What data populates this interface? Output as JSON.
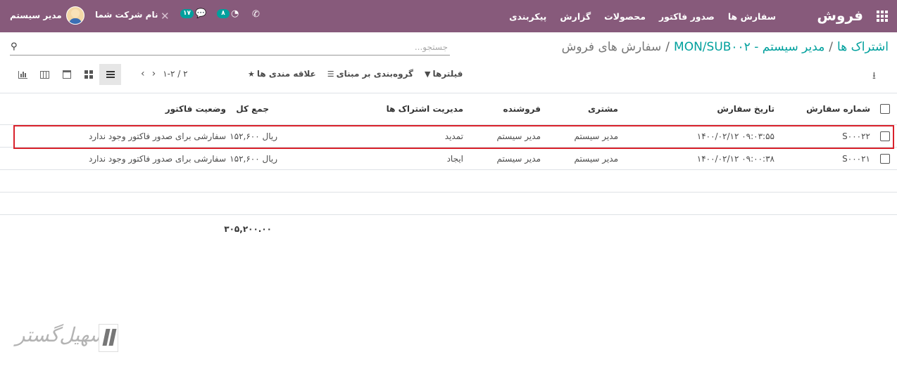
{
  "navbar": {
    "brand": "فروش",
    "menu": [
      "سفارش ها",
      "صدور فاکتور",
      "محصولات",
      "گزارش",
      "پیکربندی"
    ],
    "user_name": "مدیر سیستم",
    "company": "نام شرکت شما",
    "messages_count": "۱۷",
    "activities_count": "۸"
  },
  "breadcrumb": {
    "items": [
      "اشتراک ها",
      "MON/SUB۰۰۲ - مدیر سیستم"
    ],
    "current": "سفارش های فروش",
    "separator": "/"
  },
  "search": {
    "placeholder": "جستجو...",
    "value": ""
  },
  "filters": {
    "filters": "فیلترها",
    "group_by": "گروه‌بندی بر مبنای",
    "favorites": "علاقه مندی ها"
  },
  "pager": {
    "value": "۱-۲ / ۲"
  },
  "table": {
    "columns": {
      "order_number": "شماره سفارش",
      "order_date": "تاریخ سفارش",
      "customer": "مشتری",
      "salesperson": "فروشنده",
      "subscription_management": "مدیریت اشتراک ها",
      "total": "جمع کل",
      "invoice_status": "وضعیت فاکتور"
    },
    "rows": [
      {
        "order_number": "S۰۰۰۲۲",
        "order_date": "۱۴۰۰/۰۲/۱۲ ۰۹:۰۳:۵۵",
        "customer": "مدیر سیستم",
        "salesperson": "مدیر سیستم",
        "subscription_management": "تمدید",
        "total": "۱۵۲,۶۰۰ ریال",
        "invoice_status": "سفارشی برای صدور فاکتور وجود ندارد"
      },
      {
        "order_number": "S۰۰۰۲۱",
        "order_date": "۱۴۰۰/۰۲/۱۲ ۰۹:۰۰:۳۸",
        "customer": "مدیر سیستم",
        "salesperson": "مدیر سیستم",
        "subscription_management": "ایجاد",
        "total": "۱۵۲,۶۰۰ ریال",
        "invoice_status": "سفارشی برای صدور فاکتور وجود ندارد"
      }
    ],
    "grand_total": "۳۰۵,۲۰۰.۰۰"
  },
  "watermark": {
    "text": "تسهیل‌گستر"
  }
}
